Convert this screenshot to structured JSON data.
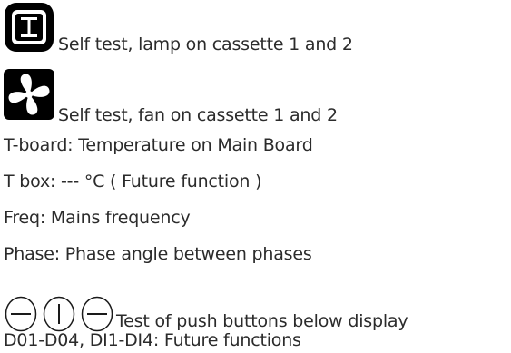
{
  "items": [
    {
      "icon": "lamp-icon",
      "text": "Self test, lamp on cassette 1 and 2"
    },
    {
      "icon": "fan-icon",
      "text": "Self test, fan on cassette 1 and 2"
    },
    {
      "text": "T-board: Temperature on Main Board"
    },
    {
      "text": "T box: --- °C  ( Future function )"
    },
    {
      "text": "Freq: Mains frequency"
    },
    {
      "text": "Phase: Phase angle between phases"
    },
    {
      "icons": [
        "minus-button-icon",
        "vertical-bar-button-icon",
        "minus-button-icon"
      ],
      "text": "Test of push buttons below display"
    },
    {
      "text": "D01-D04, DI1-DI4: Future functions"
    }
  ]
}
